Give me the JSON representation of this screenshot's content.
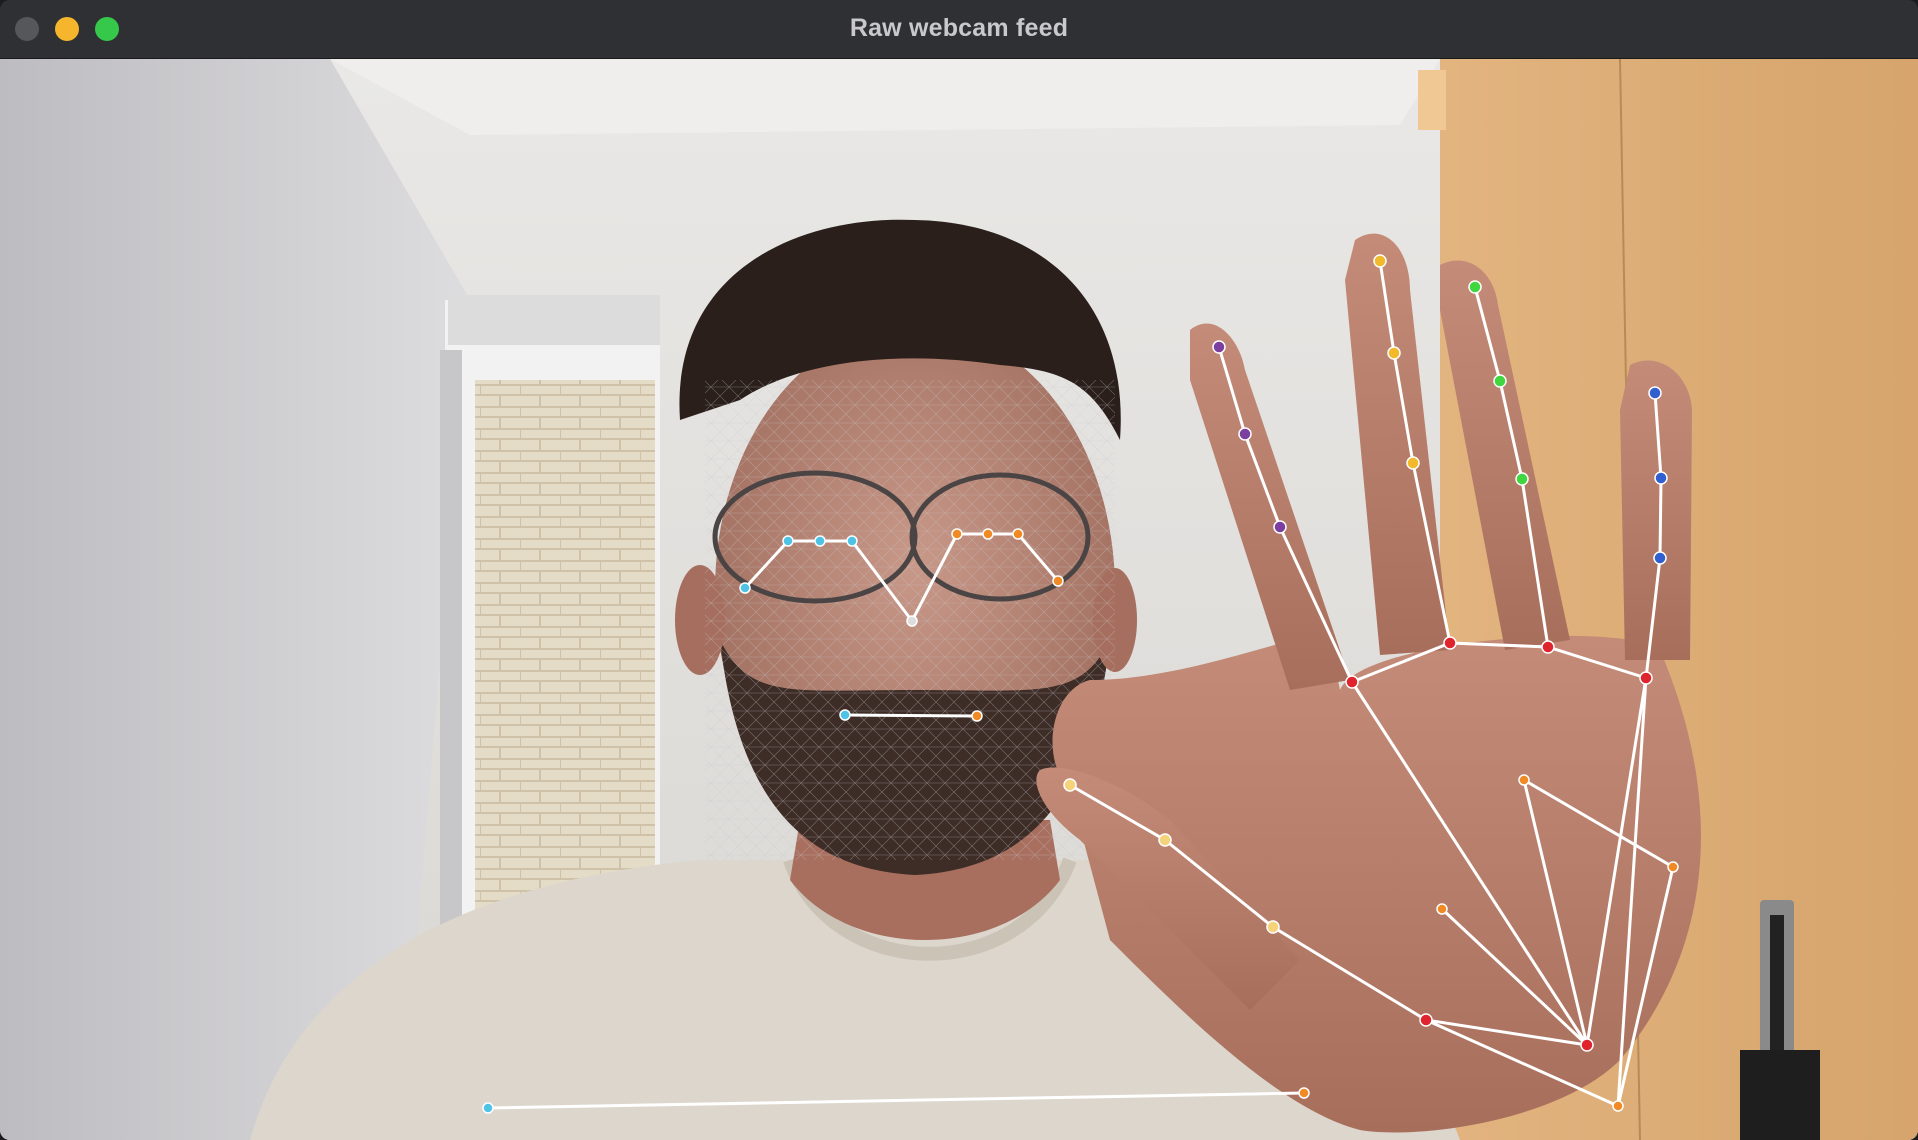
{
  "window": {
    "title": "Raw webcam feed",
    "controls": [
      "close-button",
      "minimize-button",
      "maximize-button"
    ]
  },
  "feed": {
    "description_colors": {
      "face_landmark_left": "#4fc3e6",
      "face_landmark_right": "#f08a24",
      "thumb": "#f5d37a",
      "index": "#7b3fa0",
      "middle": "#f2b92a",
      "ring": "#3fd63f",
      "pinky": "#3060d0",
      "palm_joint": "#e0242e",
      "overlay_line": "#ffffff"
    }
  }
}
